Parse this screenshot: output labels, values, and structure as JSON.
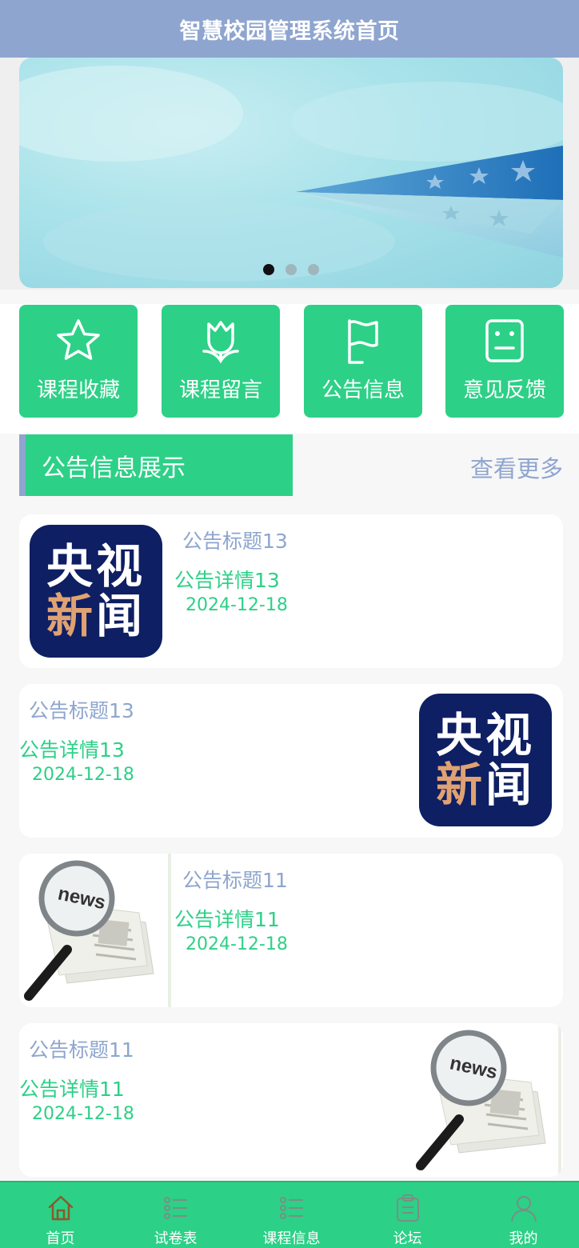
{
  "header": {
    "title": "智慧校园管理系统首页"
  },
  "banner": {
    "slides": 3,
    "active_index": 0
  },
  "quick_menu": [
    {
      "label": "课程收藏",
      "icon": "star-icon"
    },
    {
      "label": "课程留言",
      "icon": "tulip-icon"
    },
    {
      "label": "公告信息",
      "icon": "flag-icon"
    },
    {
      "label": "意见反馈",
      "icon": "feedback-face-icon"
    }
  ],
  "section": {
    "title": "公告信息展示",
    "more": "查看更多"
  },
  "news": [
    {
      "title": "公告标题13",
      "detail": "公告详情13",
      "date": "2024-12-18",
      "image": "cctv-news-logo",
      "image_text_top": "央视",
      "image_text_bottom_a": "新",
      "image_text_bottom_b": "闻"
    },
    {
      "title": "公告标题13",
      "detail": "公告详情13",
      "date": "2024-12-18",
      "image": "cctv-news-logo",
      "image_text_top": "央视",
      "image_text_bottom_a": "新",
      "image_text_bottom_b": "闻"
    },
    {
      "title": "公告标题11",
      "detail": "公告详情11",
      "date": "2024-12-18",
      "image": "newspaper-magnifier"
    },
    {
      "title": "公告标题11",
      "detail": "公告详情11",
      "date": "2024-12-18",
      "image": "newspaper-magnifier"
    }
  ],
  "tabbar": [
    {
      "label": "首页",
      "icon": "home-icon",
      "active": true
    },
    {
      "label": "试卷表",
      "icon": "list-icon",
      "active": false
    },
    {
      "label": "课程信息",
      "icon": "list-icon",
      "active": false
    },
    {
      "label": "论坛",
      "icon": "clipboard-icon",
      "active": false
    },
    {
      "label": "我的",
      "icon": "user-icon",
      "active": false
    }
  ],
  "colors": {
    "header": "#8ea5cf",
    "accent_green": "#2dd087",
    "muted_blue": "#8ea5cf",
    "cctv_navy": "#0e1f63",
    "cctv_orange": "#e0a272",
    "active_tab_icon": "#8a5a2b"
  }
}
